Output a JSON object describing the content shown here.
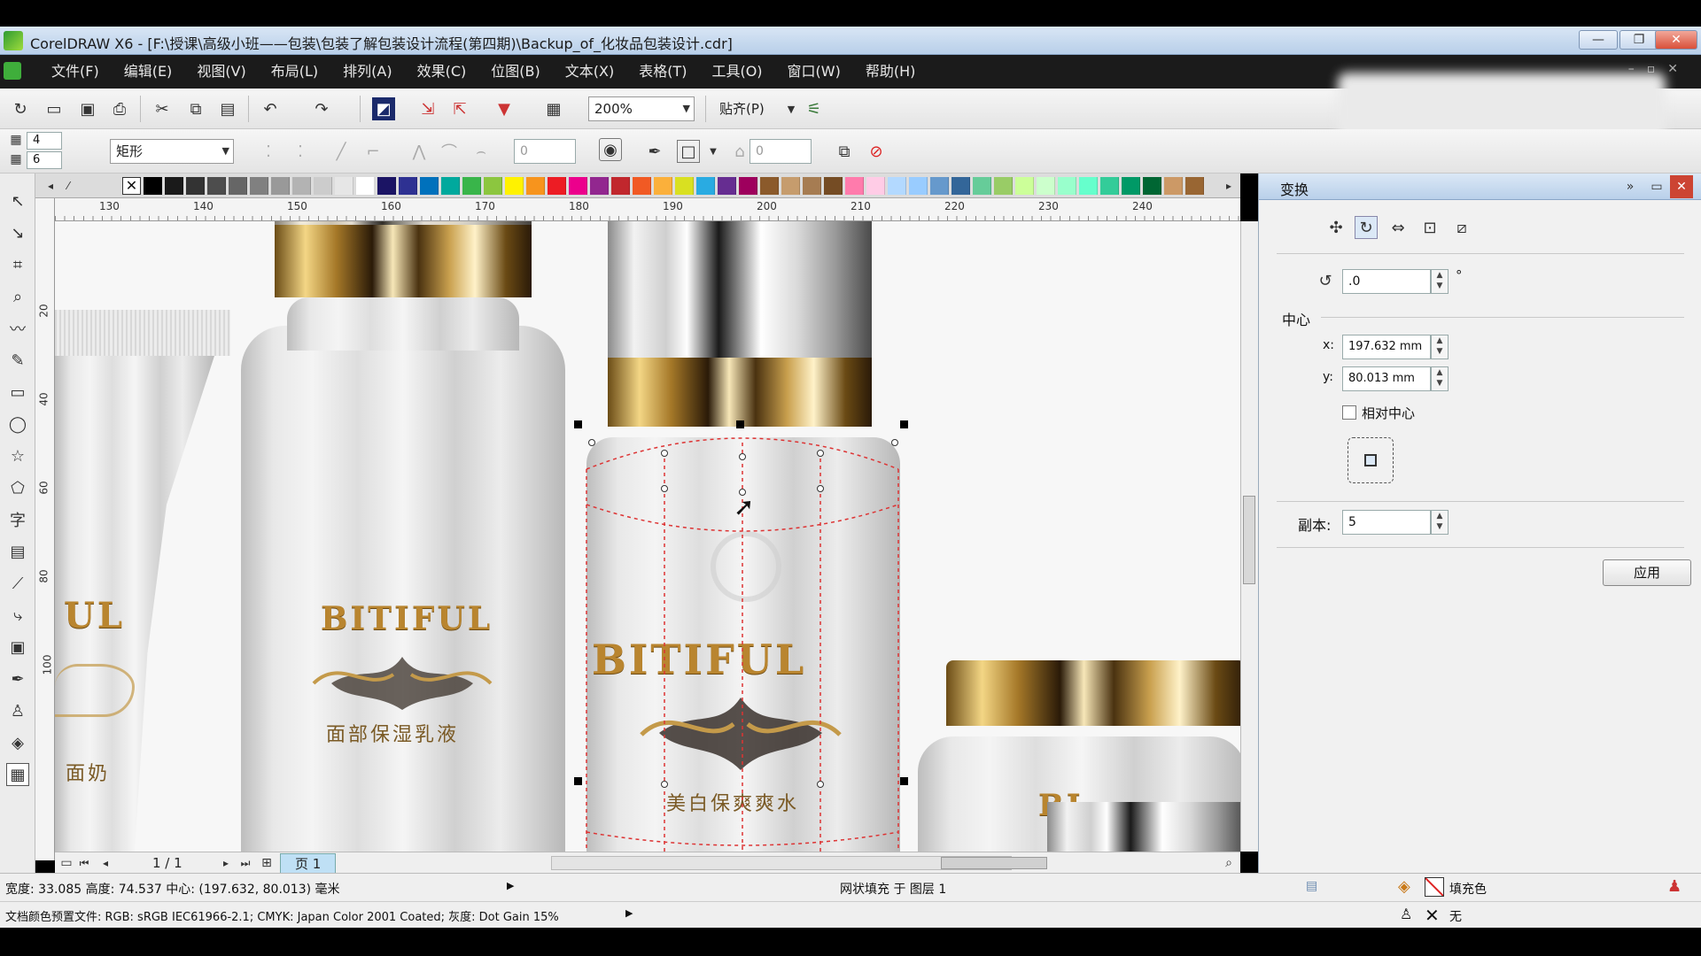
{
  "titlebar": {
    "title": "CorelDRAW X6 - [F:\\授课\\高级小班——包装\\包装了解包装设计流程(第四期)\\Backup_of_化妆品包装设计.cdr]",
    "minimize": "—",
    "restore": "❐",
    "close": "✕"
  },
  "menubar": {
    "items": [
      "文件(F)",
      "编辑(E)",
      "视图(V)",
      "布局(L)",
      "排列(A)",
      "效果(C)",
      "位图(B)",
      "文本(X)",
      "表格(T)",
      "工具(O)",
      "窗口(W)",
      "帮助(H)"
    ],
    "right_controls": "–▫✕"
  },
  "standard_toolbar": {
    "zoom_level": "200%",
    "snap_label": "贴齐(P)"
  },
  "property_bar": {
    "count_top": "4",
    "count_bottom": "6",
    "shape_select": "矩形",
    "outline_value_1": "0",
    "outline_value_2": "0"
  },
  "ruler": {
    "h_ticks": [
      "130",
      "140",
      "150",
      "160",
      "170",
      "180",
      "190",
      "200",
      "210",
      "220",
      "230",
      "240"
    ],
    "v_ticks": [
      "20",
      "40",
      "60",
      "80",
      "100"
    ],
    "unit_short": "毫米"
  },
  "canvas": {
    "brand_text": "BITIFUL",
    "brand_partial": "UL",
    "bottle1_label": "面部保湿乳液",
    "bottle2_label": "美白保爽爽水",
    "tube_label": "面奶",
    "jar_brand_partial": "BI"
  },
  "page_nav": {
    "page_counter": "1 / 1",
    "page_tab": "页 1"
  },
  "docker": {
    "title": "变换",
    "rotation_value": ".0",
    "degree_symbol": "°",
    "center_label": "中心",
    "x_label": "x:",
    "x_value": "197.632 mm",
    "y_label": "y:",
    "y_value": "80.013 mm",
    "relative_center_label": "相对中心",
    "copies_label": "副本:",
    "copies_value": "5",
    "apply_label": "应用"
  },
  "status": {
    "dimensions": "宽度: 33.085 高度: 74.537 中心: (197.632, 80.013) 毫米",
    "layer_info": "网状填充 于 图层 1",
    "fill_label": "填充色",
    "outline_label": "无",
    "color_profile": "文档颜色预置文件: RGB: sRGB IEC61966-2.1; CMYK: Japan Color 2001 Coated; 灰度: Dot Gain 15%"
  },
  "palette": {
    "colors": [
      "#000000",
      "#1a1a1a",
      "#333333",
      "#4d4d4d",
      "#666666",
      "#808080",
      "#999999",
      "#b3b3b3",
      "#cccccc",
      "#e6e6e6",
      "#ffffff",
      "#1b1464",
      "#2e3192",
      "#0071bc",
      "#00a99d",
      "#39b54a",
      "#8cc63f",
      "#fff200",
      "#f7941d",
      "#ed1c24",
      "#ec008c",
      "#92278f",
      "#c1272d",
      "#f15a24",
      "#fbb03b",
      "#d9e021",
      "#29abe2",
      "#662d91",
      "#9e005d",
      "#8b5a2b",
      "#c69c6d",
      "#a67c52",
      "#754c24",
      "#ff7bac",
      "#ffcce6",
      "#b3d9ff",
      "#99ccff",
      "#6699cc",
      "#336699",
      "#66cc99",
      "#99cc66",
      "#ccff99",
      "#ccffcc",
      "#99ffcc",
      "#66ffcc",
      "#33cc99",
      "#009966",
      "#006633",
      "#cc9966",
      "#996633"
    ]
  }
}
